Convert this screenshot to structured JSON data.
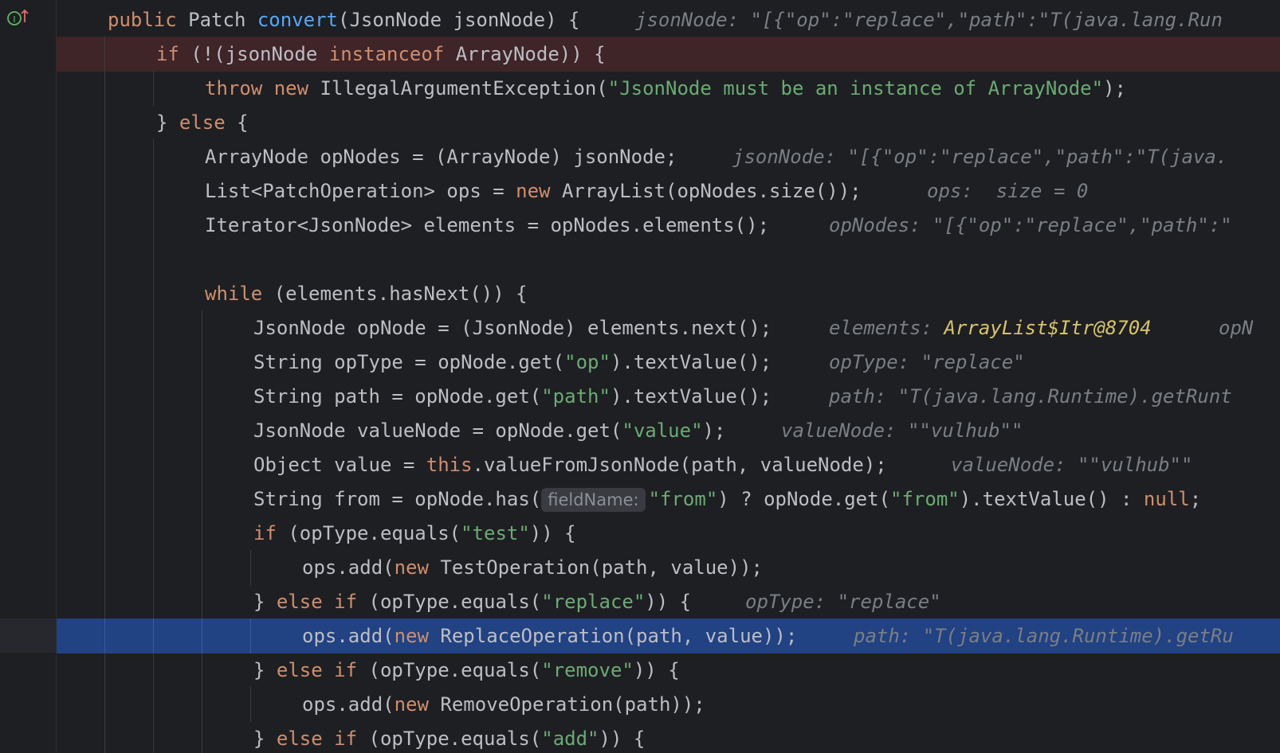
{
  "gutter": {
    "implement_icon": "implements-up-arrow-icon"
  },
  "hints": {
    "h0": "jsonNode: \"[{\"op\":\"replace\",\"path\":\"T(java.lang.Run",
    "h4": "jsonNode: \"[{\"op\":\"replace\",\"path\":\"T(java.",
    "h5": "ops:  size = 0",
    "h6": "opNodes: \"[{\"op\":\"replace\",\"path\":\"",
    "h9a": "elements: ",
    "h9b": "ArrayList$Itr@8704",
    "h9c": "opN",
    "h10": "opType: \"replace\"",
    "h11": "path: \"T(java.lang.Runtime).getRunt",
    "h12": "valueNode: \"\"vulhub\"\"",
    "h13": "valueNode: \"\"vulhub\"\"",
    "h17": "opType: \"replace\"",
    "h18": "path: \"T(java.lang.Runtime).getRu",
    "param_fieldname": "fieldName:"
  },
  "code": {
    "l0": [
      "public",
      "Patch",
      "convert",
      "(JsonNode jsonNode) {"
    ],
    "l1": [
      "if",
      "(!(jsonNode",
      "instanceof",
      "ArrayNode)) {"
    ],
    "l2": [
      "throw",
      "new",
      "IllegalArgumentException(",
      "\"JsonNode must be an instance of ArrayNode\"",
      ");"
    ],
    "l3": [
      "} ",
      "else",
      " {"
    ],
    "l4": [
      "ArrayNode opNodes = (ArrayNode) jsonNode;"
    ],
    "l5": [
      "List<PatchOperation> ops = ",
      "new",
      " ArrayList(opNodes.size());"
    ],
    "l6": [
      "Iterator<JsonNode> elements = opNodes.elements();"
    ],
    "l8": [
      "while",
      " (elements.hasNext()) {"
    ],
    "l9": [
      "JsonNode opNode = (JsonNode) elements.next();"
    ],
    "l10": [
      "String opType = opNode.get(",
      "\"op\"",
      ").textValue();"
    ],
    "l11": [
      "String path = opNode.get(",
      "\"path\"",
      ").textValue();"
    ],
    "l12": [
      "JsonNode valueNode = opNode.get(",
      "\"value\"",
      ");"
    ],
    "l13": [
      "Object value = ",
      "this",
      ".valueFromJsonNode(path, valueNode);"
    ],
    "l14": [
      "String from = opNode.has(",
      "\"from\"",
      ") ? opNode.get(",
      "\"from\"",
      ").textValue() : ",
      "null",
      ";"
    ],
    "l15": [
      "if",
      " (opType.equals(",
      "\"test\"",
      ")) {"
    ],
    "l16": [
      "ops.add(",
      "new",
      " TestOperation(path, value));"
    ],
    "l17": [
      "} ",
      "else if",
      " (opType.equals(",
      "\"replace\"",
      ")) {"
    ],
    "l18": [
      "ops.add(",
      "new",
      " ReplaceOperation(path, value));"
    ],
    "l19": [
      "} ",
      "else if",
      " (opType.equals(",
      "\"remove\"",
      ")) {"
    ],
    "l20": [
      "ops.add(",
      "new",
      " RemoveOperation(path));"
    ],
    "l21": [
      "} ",
      "else if",
      " (opType.equals(",
      "\"add\"",
      ")) {"
    ]
  },
  "colors": {
    "background": "#1e1f22",
    "keyword": "#cf8e6d",
    "function": "#56a8f5",
    "string": "#6aab73",
    "hint": "#7a7e85",
    "error_line": "#3f2428",
    "current_line": "#214283"
  }
}
